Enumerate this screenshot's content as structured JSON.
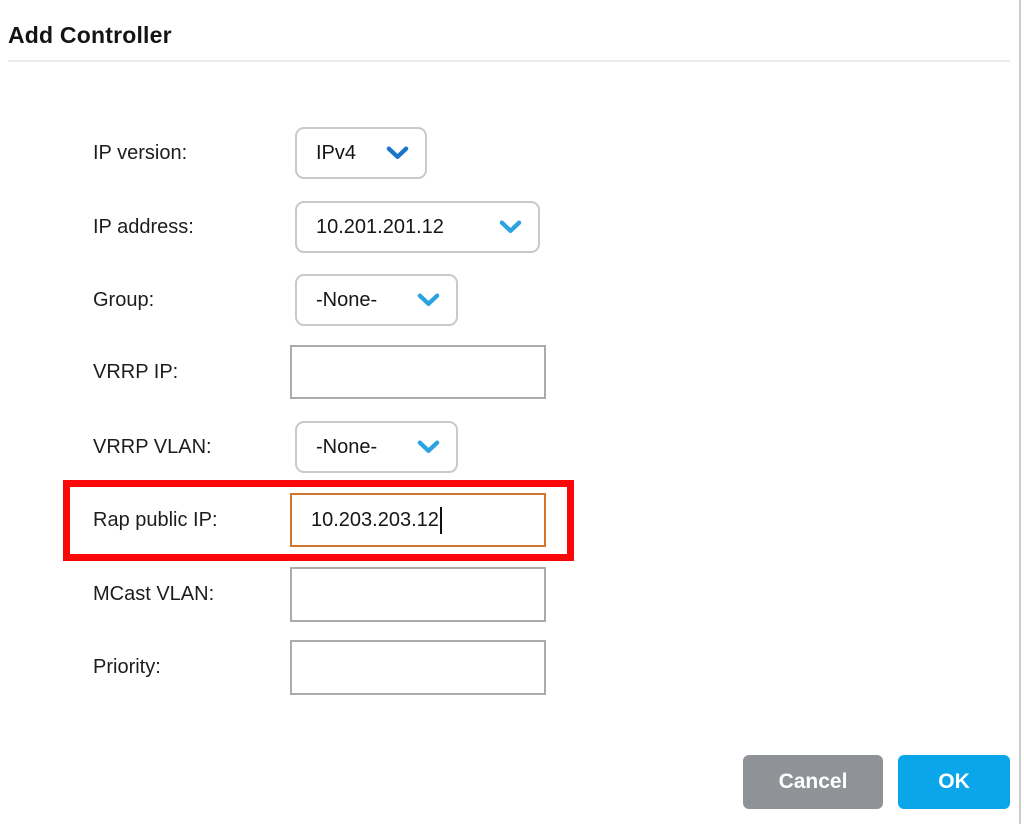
{
  "page": {
    "title": "Add Controller"
  },
  "form": {
    "rows": [
      {
        "label": "IP version:",
        "control": "dropdown",
        "value": "IPv4"
      },
      {
        "label": "IP address:",
        "control": "dropdown",
        "value": "10.201.201.12"
      },
      {
        "label": "Group:",
        "control": "dropdown",
        "value": "-None-"
      },
      {
        "label": "VRRP IP:",
        "control": "text",
        "value": ""
      },
      {
        "label": "VRRP VLAN:",
        "control": "dropdown",
        "value": "-None-"
      },
      {
        "label": "Rap public IP:",
        "control": "text",
        "value": "10.203.203.12",
        "focused": true,
        "highlighted": true
      },
      {
        "label": "MCast VLAN:",
        "control": "text",
        "value": ""
      },
      {
        "label": "Priority:",
        "control": "text",
        "value": ""
      }
    ]
  },
  "buttons": {
    "cancel_label": "Cancel",
    "ok_label": "OK"
  },
  "icons": {
    "dropdown_chevron": "chevron-down"
  },
  "colors": {
    "ok_button": "#0ba6ea",
    "cancel_button": "#8f9397",
    "annotation_red": "#fb0709",
    "focused_input_border": "#d1752c",
    "default_input_border": "#a9acae",
    "dropdown_border": "#c9c9c9",
    "chevron_blue_dark": "#1b74c5",
    "chevron_blue_light": "#2aa3e0"
  }
}
